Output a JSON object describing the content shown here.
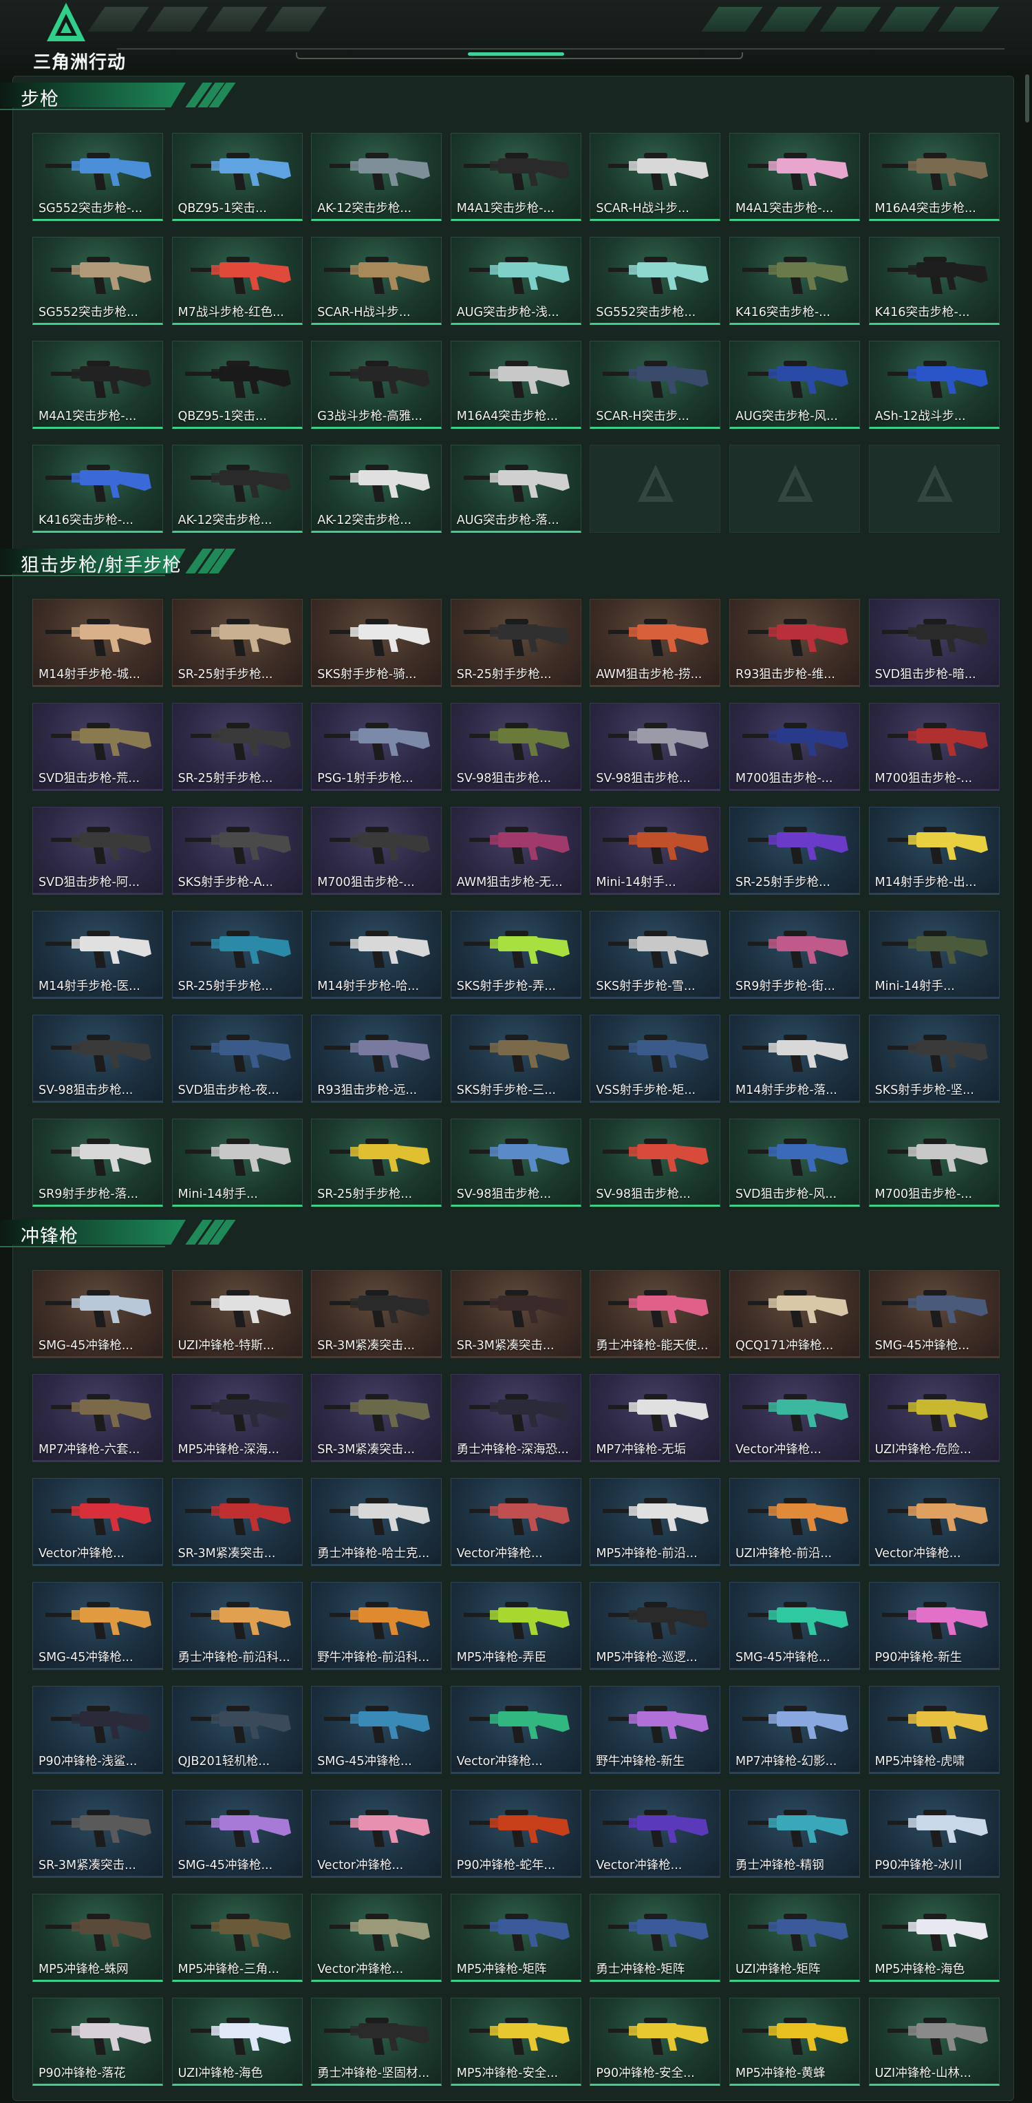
{
  "app": {
    "logo_text": "三角洲行动"
  },
  "sections": [
    {
      "title": "步枪",
      "items": [
        {
          "label": "SG552突击步枪-...",
          "rarity": "green",
          "color": "#4a8fd8"
        },
        {
          "label": "QBZ95-1突击...",
          "rarity": "green",
          "color": "#5fa3e0"
        },
        {
          "label": "AK-12突击步枪...",
          "rarity": "green",
          "color": "#7f8f9a"
        },
        {
          "label": "M4A1突击步枪-...",
          "rarity": "green",
          "color": "#2a2a2a"
        },
        {
          "label": "SCAR-H战斗步...",
          "rarity": "green",
          "color": "#d8d8d8"
        },
        {
          "label": "M4A1突击步枪-...",
          "rarity": "green",
          "color": "#e8a6cf"
        },
        {
          "label": "M16A4突击步枪...",
          "rarity": "green",
          "color": "#7a6a50"
        },
        {
          "label": "SG552突击步枪...",
          "rarity": "green",
          "color": "#b09a7a"
        },
        {
          "label": "M7战斗步枪-红色...",
          "rarity": "green",
          "color": "#e04a3a"
        },
        {
          "label": "SCAR-H战斗步...",
          "rarity": "green",
          "color": "#a88a5a"
        },
        {
          "label": "AUG突击步枪-浅...",
          "rarity": "green",
          "color": "#7fd0c8"
        },
        {
          "label": "SG552突击步枪...",
          "rarity": "green",
          "color": "#8fd8d0"
        },
        {
          "label": "K416突击步枪-...",
          "rarity": "green",
          "color": "#6a7a4a"
        },
        {
          "label": "K416突击步枪-...",
          "rarity": "green",
          "color": "#1e1e1e"
        },
        {
          "label": "M4A1突击步枪-...",
          "rarity": "green",
          "color": "#222222"
        },
        {
          "label": "QBZ95-1突击...",
          "rarity": "green",
          "color": "#1a1a1a"
        },
        {
          "label": "G3战斗步枪-高雅...",
          "rarity": "green",
          "color": "#262626"
        },
        {
          "label": "M16A4突击步枪...",
          "rarity": "green",
          "color": "#c8c8c8"
        },
        {
          "label": "SCAR-H突击步...",
          "rarity": "green",
          "color": "#3a4a6a"
        },
        {
          "label": "AUG突击步枪-风...",
          "rarity": "green",
          "color": "#2a4aa8"
        },
        {
          "label": "ASh-12战斗步...",
          "rarity": "green",
          "color": "#2a55c8"
        },
        {
          "label": "K416突击步枪-...",
          "rarity": "green",
          "color": "#3a6ad8"
        },
        {
          "label": "AK-12突击步枪...",
          "rarity": "green",
          "color": "#2a2a2a"
        },
        {
          "label": "AK-12突击步枪...",
          "rarity": "green",
          "color": "#e0e0e0"
        },
        {
          "label": "AUG突击步枪-落...",
          "rarity": "green",
          "color": "#d0d0d0"
        },
        {
          "label": "",
          "rarity": "empty",
          "color": ""
        },
        {
          "label": "",
          "rarity": "empty",
          "color": ""
        },
        {
          "label": "",
          "rarity": "empty",
          "color": ""
        }
      ]
    },
    {
      "title": "狙击步枪/射手步枪",
      "items": [
        {
          "label": "M14射手步枪-城...",
          "rarity": "orange",
          "color": "#d8b08a"
        },
        {
          "label": "SR-25射手步枪...",
          "rarity": "orange",
          "color": "#c8b090"
        },
        {
          "label": "SKS射手步枪-骑...",
          "rarity": "orange",
          "color": "#e8e8e8"
        },
        {
          "label": "SR-25射手步枪...",
          "rarity": "orange",
          "color": "#303030"
        },
        {
          "label": "AWM狙击步枪-捞...",
          "rarity": "orange",
          "color": "#d8603a"
        },
        {
          "label": "R93狙击步枪-维...",
          "rarity": "orange",
          "color": "#b8303a"
        },
        {
          "label": "SVD狙击步枪-暗...",
          "rarity": "purple",
          "color": "#2a2a2a"
        },
        {
          "label": "SVD狙击步枪-荒...",
          "rarity": "purple",
          "color": "#8a7a50"
        },
        {
          "label": "SR-25射手步枪...",
          "rarity": "purple",
          "color": "#3a3a3a"
        },
        {
          "label": "PSG-1射手步枪...",
          "rarity": "purple",
          "color": "#7a8aa8"
        },
        {
          "label": "SV-98狙击步枪...",
          "rarity": "purple",
          "color": "#6a7a3a"
        },
        {
          "label": "SV-98狙击步枪...",
          "rarity": "purple",
          "color": "#9a9aa8"
        },
        {
          "label": "M700狙击步枪-...",
          "rarity": "purple",
          "color": "#2a3a8a"
        },
        {
          "label": "M700狙击步枪-...",
          "rarity": "purple",
          "color": "#b03030"
        },
        {
          "label": "SVD狙击步枪-阿...",
          "rarity": "purple",
          "color": "#3a3a3a"
        },
        {
          "label": "SKS射手步枪-A...",
          "rarity": "purple",
          "color": "#4a4a4a"
        },
        {
          "label": "M700狙击步枪-...",
          "rarity": "purple",
          "color": "#3a3a3a"
        },
        {
          "label": "AWM狙击步枪-无...",
          "rarity": "purple",
          "color": "#a03a6a"
        },
        {
          "label": "Mini-14射手...",
          "rarity": "purple",
          "color": "#c0502a"
        },
        {
          "label": "SR-25射手步枪...",
          "rarity": "blue",
          "color": "#6a3ac8"
        },
        {
          "label": "M14射手步枪-出...",
          "rarity": "blue",
          "color": "#e8d040"
        },
        {
          "label": "M14射手步枪-医...",
          "rarity": "blue",
          "color": "#e0e0e0"
        },
        {
          "label": "SR-25射手步枪...",
          "rarity": "blue",
          "color": "#2a8aa8"
        },
        {
          "label": "M14射手步枪-哈...",
          "rarity": "blue",
          "color": "#d8d8d8"
        },
        {
          "label": "SKS射手步枪-弄...",
          "rarity": "blue",
          "color": "#a8e040"
        },
        {
          "label": "SKS射手步枪-雪...",
          "rarity": "blue",
          "color": "#c8c8c8"
        },
        {
          "label": "SR9射手步枪-街...",
          "rarity": "blue",
          "color": "#c05a8a"
        },
        {
          "label": "Mini-14射手...",
          "rarity": "blue",
          "color": "#4a5a3a"
        },
        {
          "label": "SV-98狙击步枪...",
          "rarity": "blue",
          "color": "#3a3a3a"
        },
        {
          "label": "SVD狙击步枪-夜...",
          "rarity": "blue",
          "color": "#3a5a8a"
        },
        {
          "label": "R93狙击步枪-远...",
          "rarity": "blue",
          "color": "#7a7aa0"
        },
        {
          "label": "SKS射手步枪-三...",
          "rarity": "blue",
          "color": "#7a6a4a"
        },
        {
          "label": "VSS射手步枪-矩...",
          "rarity": "blue",
          "color": "#3a5a8a"
        },
        {
          "label": "M14射手步枪-落...",
          "rarity": "blue",
          "color": "#d8d8d8"
        },
        {
          "label": "SKS射手步枪-坚...",
          "rarity": "blue",
          "color": "#3a3a3a"
        },
        {
          "label": "SR9射手步枪-落...",
          "rarity": "green",
          "color": "#d8d8d8"
        },
        {
          "label": "Mini-14射手...",
          "rarity": "green",
          "color": "#c8c8c8"
        },
        {
          "label": "SR-25射手步枪...",
          "rarity": "green",
          "color": "#e0c030"
        },
        {
          "label": "SV-98狙击步枪...",
          "rarity": "green",
          "color": "#5a8ac8"
        },
        {
          "label": "SV-98狙击步枪...",
          "rarity": "green",
          "color": "#d84a3a"
        },
        {
          "label": "SVD狙击步枪-风...",
          "rarity": "green",
          "color": "#3a6ab8"
        },
        {
          "label": "M700狙击步枪-...",
          "rarity": "green",
          "color": "#c8c8c8"
        }
      ]
    },
    {
      "title": "冲锋枪",
      "items": [
        {
          "label": "SMG-45冲锋枪...",
          "rarity": "orange",
          "color": "#b8c8d8"
        },
        {
          "label": "UZI冲锋枪-特斯...",
          "rarity": "orange",
          "color": "#e0e0e0"
        },
        {
          "label": "SR-3M紧凑突击...",
          "rarity": "orange",
          "color": "#2a2a2a"
        },
        {
          "label": "SR-3M紧凑突击...",
          "rarity": "orange",
          "color": "#3a2a2a"
        },
        {
          "label": "勇士冲锋枪-能天使...",
          "rarity": "orange",
          "color": "#e0608a"
        },
        {
          "label": "QCQ171冲锋枪...",
          "rarity": "orange",
          "color": "#d8c8a8"
        },
        {
          "label": "SMG-45冲锋枪...",
          "rarity": "orange",
          "color": "#4a5a7a"
        },
        {
          "label": "MP7冲锋枪-六套...",
          "rarity": "purple",
          "color": "#7a6a4a"
        },
        {
          "label": "MP5冲锋枪-深海...",
          "rarity": "purple",
          "color": "#2a2a3a"
        },
        {
          "label": "SR-3M紧凑突击...",
          "rarity": "purple",
          "color": "#6a6a4a"
        },
        {
          "label": "勇士冲锋枪-深海恐...",
          "rarity": "purple",
          "color": "#2a2a3a"
        },
        {
          "label": "MP7冲锋枪-无垢",
          "rarity": "purple",
          "color": "#e0e0e0"
        },
        {
          "label": "Vector冲锋枪...",
          "rarity": "purple",
          "color": "#3ab8a0"
        },
        {
          "label": "UZI冲锋枪-危险...",
          "rarity": "purple",
          "color": "#c8b830"
        },
        {
          "label": "Vector冲锋枪...",
          "rarity": "blue",
          "color": "#d8303a"
        },
        {
          "label": "SR-3M紧凑突击...",
          "rarity": "blue",
          "color": "#c03030"
        },
        {
          "label": "勇士冲锋枪-哈士克...",
          "rarity": "blue",
          "color": "#d8d8d8"
        },
        {
          "label": "Vector冲锋枪...",
          "rarity": "blue",
          "color": "#c05050"
        },
        {
          "label": "MP5冲锋枪-前沿...",
          "rarity": "blue",
          "color": "#e0e0e0"
        },
        {
          "label": "UZI冲锋枪-前沿...",
          "rarity": "blue",
          "color": "#e08a3a"
        },
        {
          "label": "Vector冲锋枪...",
          "rarity": "blue",
          "color": "#e0a060"
        },
        {
          "label": "SMG-45冲锋枪...",
          "rarity": "blue",
          "color": "#e09a40"
        },
        {
          "label": "勇士冲锋枪-前沿科...",
          "rarity": "blue",
          "color": "#e0a050"
        },
        {
          "label": "野牛冲锋枪-前沿科...",
          "rarity": "blue",
          "color": "#e08a30"
        },
        {
          "label": "MP5冲锋枪-弄臣",
          "rarity": "blue",
          "color": "#a8d830"
        },
        {
          "label": "MP5冲锋枪-巡逻...",
          "rarity": "blue",
          "color": "#2a2a2a"
        },
        {
          "label": "SMG-45冲锋枪...",
          "rarity": "blue",
          "color": "#30c8a0"
        },
        {
          "label": "P90冲锋枪-新生",
          "rarity": "blue",
          "color": "#e070c8"
        },
        {
          "label": "P90冲锋枪-浅鲨...",
          "rarity": "blue",
          "color": "#2a2a3a"
        },
        {
          "label": "QJB201轻机枪...",
          "rarity": "blue",
          "color": "#3a4a5a"
        },
        {
          "label": "SMG-45冲锋枪...",
          "rarity": "blue",
          "color": "#3a8ab8"
        },
        {
          "label": "Vector冲锋枪...",
          "rarity": "blue",
          "color": "#30b880"
        },
        {
          "label": "野牛冲锋枪-新生",
          "rarity": "blue",
          "color": "#b070d8"
        },
        {
          "label": "MP7冲锋枪-幻影...",
          "rarity": "blue",
          "color": "#8aa8e0"
        },
        {
          "label": "MP5冲锋枪-虎啸",
          "rarity": "blue",
          "color": "#e8c040"
        },
        {
          "label": "SR-3M紧凑突击...",
          "rarity": "blue",
          "color": "#5a5a5a"
        },
        {
          "label": "SMG-45冲锋枪...",
          "rarity": "blue",
          "color": "#a87ad8"
        },
        {
          "label": "Vector冲锋枪...",
          "rarity": "blue",
          "color": "#e890b0"
        },
        {
          "label": "P90冲锋枪-蛇年...",
          "rarity": "blue",
          "color": "#c8401a"
        },
        {
          "label": "Vector冲锋枪...",
          "rarity": "blue",
          "color": "#5a3ab8"
        },
        {
          "label": "勇士冲锋枪-精钢",
          "rarity": "blue",
          "color": "#3aa8b8"
        },
        {
          "label": "P90冲锋枪-冰川",
          "rarity": "blue",
          "color": "#c8d8e8"
        },
        {
          "label": "MP5冲锋枪-蛛网",
          "rarity": "green",
          "color": "#5a4a3a"
        },
        {
          "label": "MP5冲锋枪-三角...",
          "rarity": "green",
          "color": "#6a5a3a"
        },
        {
          "label": "Vector冲锋枪...",
          "rarity": "green",
          "color": "#9a9a7a"
        },
        {
          "label": "MP5冲锋枪-矩阵",
          "rarity": "green",
          "color": "#3a5a9a"
        },
        {
          "label": "勇士冲锋枪-矩阵",
          "rarity": "green",
          "color": "#3a5a9a"
        },
        {
          "label": "UZI冲锋枪-矩阵",
          "rarity": "green",
          "color": "#3a5a9a"
        },
        {
          "label": "MP5冲锋枪-海色",
          "rarity": "green",
          "color": "#e8e8f0"
        },
        {
          "label": "P90冲锋枪-落花",
          "rarity": "green",
          "color": "#d8d0d8"
        },
        {
          "label": "UZI冲锋枪-海色",
          "rarity": "green",
          "color": "#e0e8f8"
        },
        {
          "label": "勇士冲锋枪-坚固材...",
          "rarity": "green",
          "color": "#2a2a2a"
        },
        {
          "label": "MP5冲锋枪-安全...",
          "rarity": "green",
          "color": "#e8c830"
        },
        {
          "label": "P90冲锋枪-安全...",
          "rarity": "green",
          "color": "#e8c830"
        },
        {
          "label": "MP5冲锋枪-黄蜂",
          "rarity": "green",
          "color": "#e8c020"
        },
        {
          "label": "UZI冲锋枪-山林...",
          "rarity": "green",
          "color": "#8a8a8a"
        }
      ]
    }
  ]
}
